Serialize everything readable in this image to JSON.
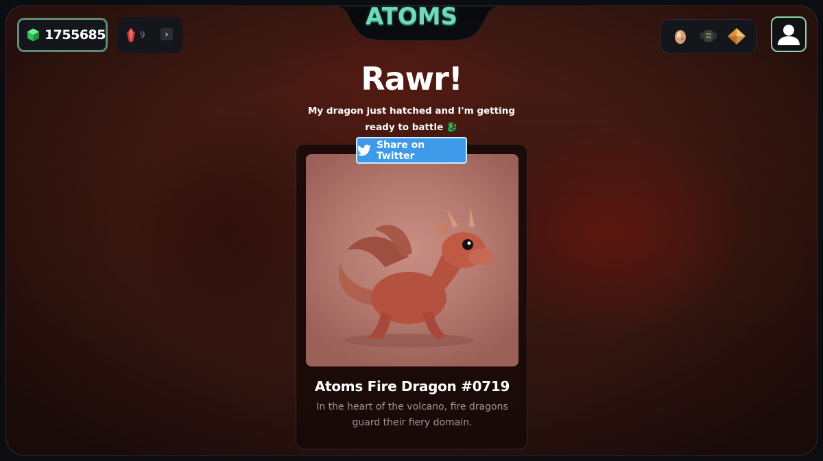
{
  "header": {
    "logo": "ATOMS",
    "balance": "1755685",
    "crystal_count": "9",
    "expand_icon": "chevron-right-icon",
    "inventory": [
      "egg-icon",
      "armor-icon",
      "gold-diamond-icon"
    ],
    "profile_icon": "user-icon"
  },
  "main": {
    "headline": "Rawr!",
    "subline": "My dragon just hatched and I'm getting ready to battle 🐉",
    "share_label": "Share on Twitter"
  },
  "card": {
    "title": "Atoms Fire Dragon #0719",
    "description": "In the heart of the volcano, fire dragons guard their fiery domain."
  },
  "colors": {
    "accent_green": "#6fd9b8",
    "twitter_blue": "#3e9ae9",
    "balance_border": "#5e8c78",
    "profile_border": "#8fd3a8"
  }
}
